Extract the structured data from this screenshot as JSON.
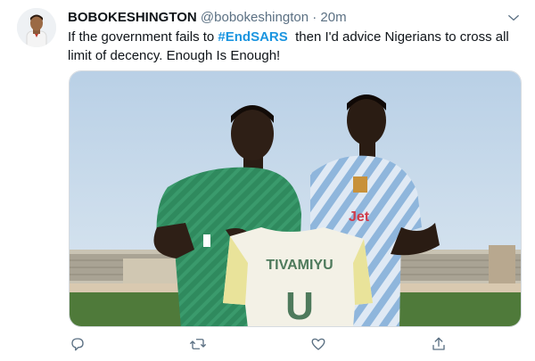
{
  "user": {
    "display_name": "BOBOKESHINGTON",
    "handle": "@bobokeshington",
    "separator": "·",
    "time": "20m"
  },
  "tweet": {
    "text_before": "If the government fails to ",
    "hashtag": "#EndSARS",
    "text_after": "  then I'd advice Nigerians to cross all limit of decency. Enough Is Enough!"
  },
  "media": {
    "jersey_text": "TIVAMIYU",
    "jersey_number": "U",
    "sponsor_text": "Jet"
  },
  "icons": {
    "caret": "chevron-down-icon",
    "reply": "reply-icon",
    "retweet": "retweet-icon",
    "like": "like-icon",
    "share": "share-icon"
  },
  "colors": {
    "link": "#1b95e0",
    "secondary_text": "#5b7083",
    "icon": "#5b7083"
  }
}
